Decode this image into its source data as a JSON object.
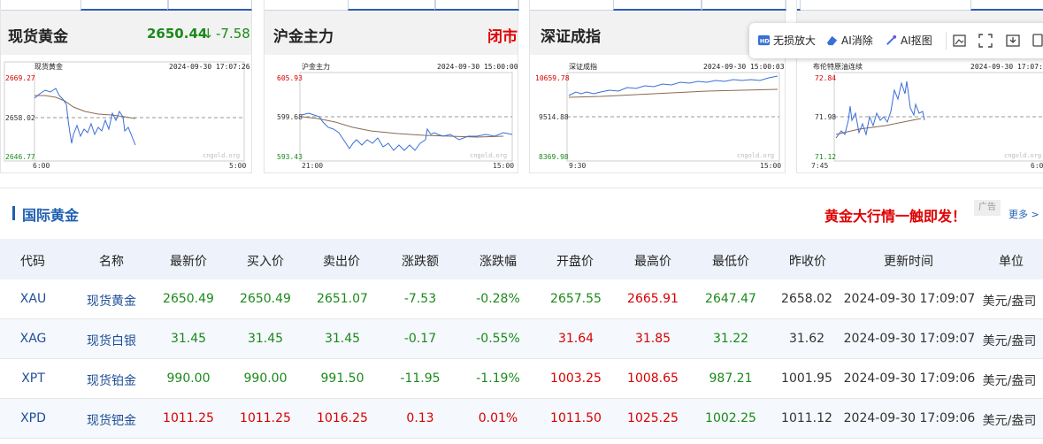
{
  "cards": [
    {
      "name": "现货黄金",
      "price": "2650.44",
      "arrow": "↓",
      "change": "-7.58",
      "chart": {
        "title": "现货黄金",
        "timestamp": "2024-09-30 17:07:26",
        "y_top": "2669.27",
        "y_mid": "2658.02",
        "y_bottom": "2646.77",
        "x_start": "6:00",
        "x_end": "5:00",
        "watermark": "cngold.org"
      }
    },
    {
      "name": "沪金主力",
      "status": "闭市",
      "chart": {
        "title": "沪金主力",
        "timestamp": "2024-09-30 15:00:00",
        "y_top": "605.93",
        "y_mid": "599.68",
        "y_bottom": "593.43",
        "x_start": "21:00",
        "x_end": "15:00",
        "watermark": "cngold.org"
      }
    },
    {
      "name": "深证成指",
      "chart": {
        "title": "深证成指",
        "timestamp": "2024-09-30 15:00:03",
        "y_top": "10659.78",
        "y_mid": "9514.88",
        "y_bottom": "8369.98",
        "x_start": "9:30",
        "x_end": "15:00",
        "watermark": "cngold.org"
      }
    },
    {
      "name": "",
      "chart": {
        "title": "布伦特原油连续",
        "timestamp": "2024-09-30 17:07:3",
        "y_top": "72.84",
        "y_mid": "71.98",
        "y_bottom": "71.12",
        "x_start": "7:45",
        "x_end": "6:0",
        "watermark": "cngold.org"
      }
    }
  ],
  "toolbar": {
    "lossless_zoom": "无损放大",
    "ai_erase": "AI消除",
    "ai_matting": "AI抠图",
    "icons": [
      "image-edit-icon",
      "crop-icon",
      "download-icon",
      "copy-icon"
    ]
  },
  "section": {
    "title": "国际黄金",
    "ad_text": "黄金大行情一触即发！",
    "ad_badge": "广告",
    "more": "更多 > >"
  },
  "table": {
    "headers": [
      "代码",
      "名称",
      "最新价",
      "买入价",
      "卖出价",
      "涨跌额",
      "涨跌幅",
      "开盘价",
      "最高价",
      "最低价",
      "昨收价",
      "更新时间",
      "单位"
    ],
    "rows": [
      [
        "XAU",
        "现货黄金",
        "2650.49",
        "2650.49",
        "2651.07",
        "-7.53",
        "-0.28%",
        "2657.55",
        "2665.91",
        "2647.47",
        "2658.02",
        "2024-09-30 17:09:07",
        "美元/盎司"
      ],
      [
        "XAG",
        "现货白银",
        "31.45",
        "31.45",
        "31.45",
        "-0.17",
        "-0.55%",
        "31.64",
        "31.85",
        "31.22",
        "31.62",
        "2024-09-30 17:09:07",
        "美元/盎司"
      ],
      [
        "XPT",
        "现货铂金",
        "990.00",
        "990.00",
        "991.50",
        "-11.95",
        "-1.19%",
        "1003.25",
        "1008.65",
        "987.21",
        "1001.95",
        "2024-09-30 17:09:06",
        "美元/盎司"
      ],
      [
        "XPD",
        "现货钯金",
        "1011.25",
        "1011.25",
        "1016.25",
        "0.13",
        "0.01%",
        "1011.50",
        "1025.25",
        "1002.25",
        "1011.12",
        "2024-09-30 17:09:06",
        "美元/盎司"
      ]
    ],
    "row_colors": [
      [
        "blue",
        "blue",
        "green",
        "green",
        "green",
        "green",
        "green",
        "green",
        "red",
        "green",
        "dark",
        "dark",
        "dark"
      ],
      [
        "blue",
        "blue",
        "green",
        "green",
        "green",
        "green",
        "green",
        "red",
        "red",
        "green",
        "dark",
        "dark",
        "dark"
      ],
      [
        "blue",
        "blue",
        "green",
        "green",
        "green",
        "green",
        "green",
        "red",
        "red",
        "green",
        "dark",
        "dark",
        "dark"
      ],
      [
        "blue",
        "blue",
        "red",
        "red",
        "red",
        "red",
        "red",
        "red",
        "red",
        "green",
        "dark",
        "dark",
        "dark"
      ]
    ]
  },
  "colors": {
    "up": "#d80000",
    "down": "#1a8a1a",
    "accent": "#1f5fb0",
    "chart_line": "#3a6fd8",
    "chart_avg": "#8a6a50"
  }
}
